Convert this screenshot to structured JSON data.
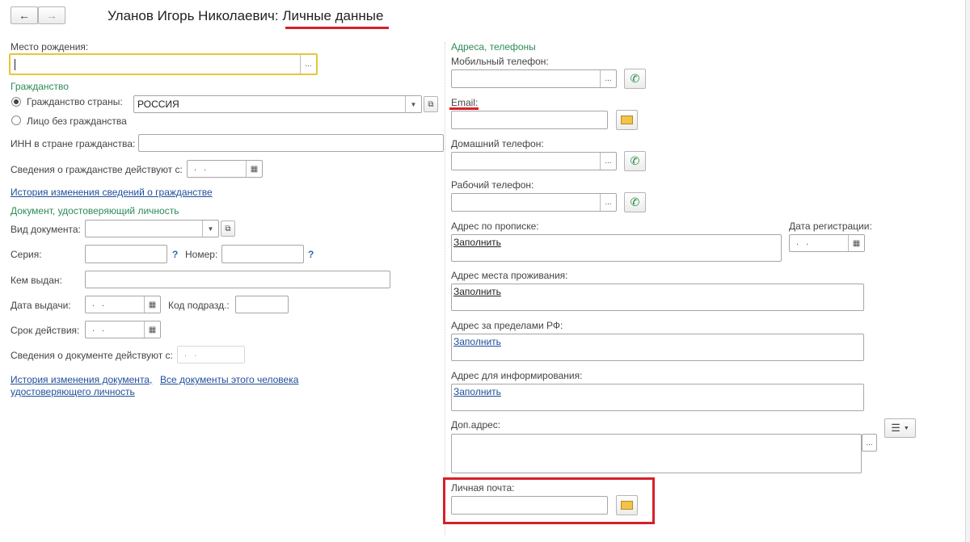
{
  "header": {
    "back_icon": "arrow-left-icon",
    "forward_icon": "arrow-right-icon",
    "title_person": "Уланов Игорь Николаевич:",
    "title_section": "Личные данные"
  },
  "left": {
    "birthplace_label": "Место рождения:",
    "birthplace_btn": "...",
    "citizenship_group": "Гражданство",
    "radio_country_label": "Гражданство страны:",
    "country_value": "РОССИЯ",
    "radio_stateless_label": "Лицо без гражданства",
    "inn_label": "ИНН в стране гражданства:",
    "citizenship_valid_label": "Сведения о гражданстве действуют с:",
    "date_placeholder": ". .",
    "citizenship_history_link": "История изменения сведений о гражданстве",
    "doc_group": "Документ, удостоверяющий личность",
    "doc_type_label": "Вид документа:",
    "series_label": "Серия:",
    "number_label": "Номер:",
    "help_mark": "?",
    "issued_by_label": "Кем выдан:",
    "issue_date_label": "Дата выдачи:",
    "dept_code_label": "Код подразд.:",
    "validity_label": "Срок действия:",
    "doc_valid_label": "Сведения о документе действуют с:",
    "doc_history_link_1": "История изменения документа,",
    "doc_history_link_2": "удостоверяющего личность",
    "all_docs_link": "Все документы этого человека"
  },
  "right": {
    "contacts_group": "Адреса, телефоны",
    "mobile_label": "Мобильный телефон:",
    "email_label": "Email:",
    "home_phone_label": "Домашний телефон:",
    "work_phone_label": "Рабочий телефон:",
    "reg_address_label": "Адрес по прописке:",
    "reg_date_label": "Дата регистрации:",
    "residence_label": "Адрес места проживания:",
    "abroad_label": "Адрес за пределами РФ:",
    "info_address_label": "Адрес для информирования:",
    "fill_link": "Заполнить",
    "extra_address_label": "Доп.адрес:",
    "personal_mail_label": "Личная почта:",
    "ellipsis": "...",
    "phone_icon": "phone-icon",
    "mail_icon": "envelope-icon",
    "menu_icon": "hamburger-menu-icon"
  },
  "colors": {
    "highlight_red": "#d7202a",
    "group_green": "#2e8b57",
    "link_blue": "#1f4e9b",
    "focus_yellow": "#e8c53a"
  }
}
